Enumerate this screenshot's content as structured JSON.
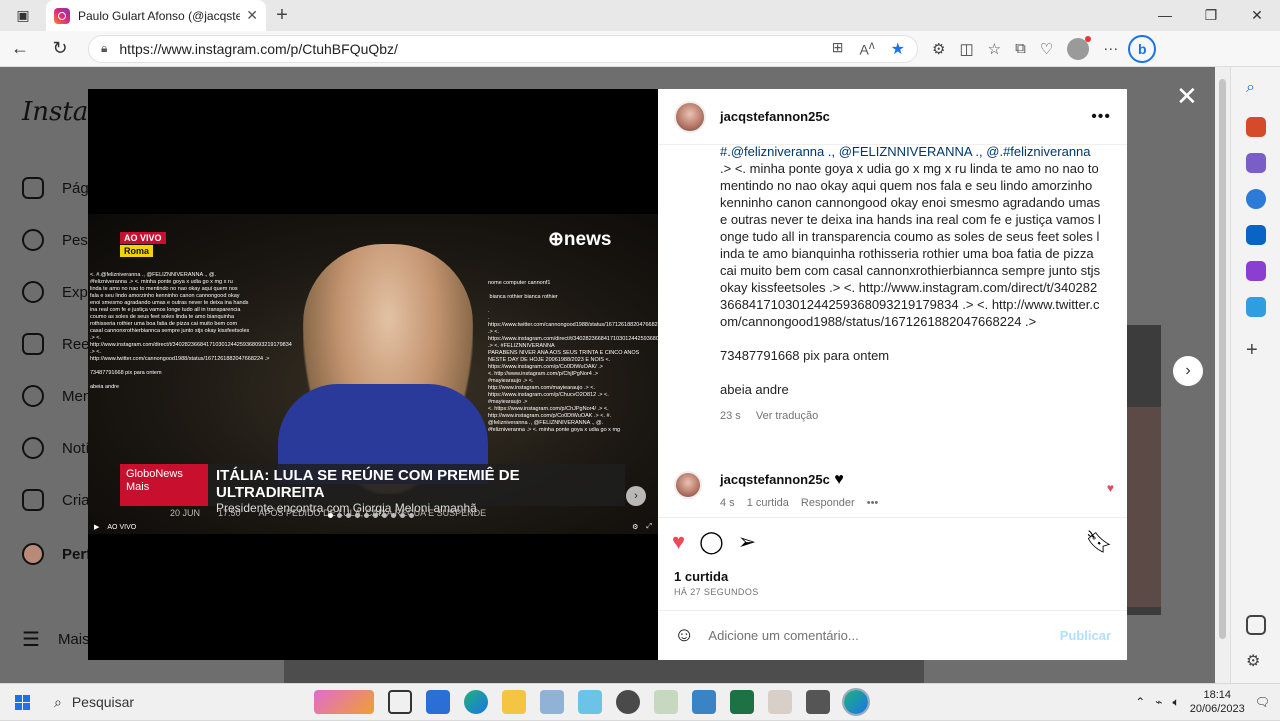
{
  "browser": {
    "tab_title": "Paulo Gulart Afonso (@jacqstefa",
    "url": "https://www.instagram.com/p/CtuhBFQuQbz/"
  },
  "instagram": {
    "logo_text": "Instag",
    "sidebar": [
      {
        "label": "Pági",
        "icon": "home-icon"
      },
      {
        "label": "Pesq",
        "icon": "search-icon"
      },
      {
        "label": "Expl",
        "icon": "compass-icon"
      },
      {
        "label": "Reel",
        "icon": "reels-icon"
      },
      {
        "label": "Men",
        "icon": "messenger-icon"
      },
      {
        "label": "Notí",
        "icon": "heart-icon"
      },
      {
        "label": "Cria",
        "icon": "plus-icon"
      },
      {
        "label": "Perf",
        "icon": "profile-avatar"
      },
      {
        "label": "Mais",
        "icon": "menu-icon"
      }
    ]
  },
  "video": {
    "live_badge": "AO VIVO",
    "city_badge": "Roma",
    "channel": "news",
    "overlay_left": "<. #.@felizniveranna ., @FELIZNNIVERANNA ., @.\n#felizniveranna .> <. minha ponte goya x udia go x mg x ru\nlinda te amo no nao to mentindo no nao okay aqui quem nos\nfala e seu lindo amorzinho kenninho canon cannongood okay\nenoi smesmo agradando umas e outras never te deixa ina hands\nina real com fe e justiça vamos longe tudo all in transparencia\ncoumo as soles de seus feet soles linda te amo bianquinha\nrothisseria rothier uma boa fatia de pizza cai muito bem com\ncasal cannonxrothierbiannca sempre junto stjs okay kissfeetsoles\n.> <.\nhttp://www.instagram.com/direct/t/340282366841710301244259368093219179834 .> <.\nhttp://www.twitter.com/cannongood1988/status/1671261882047668224 .>\n\n73487791668 pix para ontem\n\nabeia andre",
    "overlay_right": "nome computer cannonf1\n\n bianca rothier bianca rothier\n\n.\n.\nhttps://www.twitter.com/cannongood1988/status/1671261882047668224 .> <.\nhttps://www.instagram.com/direct/t/340282366841710301244259368093219179834 .> <. #FELIZNNIVERANNA\nPARABENS NIVER ANA AOS SEUS TRINTA E CINCO ANOS\nNESTE DAY DE HOJE 20061988/2023 E NOIS <.\nhttps://www.instagram.com/p/Co0DtWuOAK/ .>\n<. http://www.instagram.com/p/ChjIPgNor4 .>\n#mayiearaujo .> <.\nhttp://www.instagram.com/mayiearaujo .> <.\nhttps://www.instagram.com/p/ChucvO2O812 .> <.\n#mayiearaujo .>\n<. https://www.instagram.com/p/ChJPgNor4/ .> <.\nhttp://www.instagram.com/p/Co0DtWuOAK .> <. #.\n@felizniveranna ., @FELIZNNIVERANNA ., @.\n#felizniveranna .> <. minha ponte goya x udia go x mg",
    "lower_brand": "GloboNews Mais",
    "headline": "ITÁLIA: LULA SE REÚNE COM PREMIÊ DE ULTRADIREITA",
    "subheadline": "Presidente encontra com Giorgia Meloni amanhã",
    "ticker_date": "20 JUN",
    "ticker_time": "17:50",
    "ticker_text": "APÓS PEDIDO DE LULA, CAIXA RECUA E SUSPENDE",
    "control_live": "AO VIVO",
    "carousel_dots": 10,
    "carousel_active": 0
  },
  "post": {
    "username": "jacqstefannon25c",
    "caption_mentions": "#.@felizniveranna ., @FELIZNNIVERANNA ., @.#felizniveranna",
    "caption_body": ".> <. minha ponte goya x udia go x mg x ru linda te amo no nao to mentindo no nao okay aqui quem nos fala e seu lindo amorzinho kenninho canon cannongood okay enoi smesmo agradando umas e outras never te deixa ina hands ina real com fe e justiça vamos longe tudo all in transparencia coumo as soles de seus feet soles linda te amo bianquinha rothisseria rothier uma boa fatia de pizza cai muito bem com casal cannonxrothierbiannca sempre junto stjs okay kissfeetsoles .> <. http://www.instagram.com/direct/t/340282366841710301244259368093219179834 .> <. http://www.twitter.com/cannongood1988/status/1671261882047668224 .>",
    "caption_pix": "73487791668 pix para ontem",
    "caption_sign": "abeia andre",
    "caption_time": "23 s",
    "see_translation": "Ver tradução",
    "comment_user": "jacqstefannon25c",
    "comment_text": "♥",
    "comment_time": "4 s",
    "comment_likes": "1 curtida",
    "comment_reply": "Responder",
    "likes": "1 curtida",
    "posted_ago": "HÁ 27 SEGUNDOS",
    "add_comment_placeholder": "Adicione um comentário...",
    "publish": "Publicar"
  },
  "taskbar": {
    "search": "Pesquisar",
    "time": "18:14",
    "date": "20/06/2023"
  },
  "colors": {
    "like_red": "#ed4956",
    "link_blue": "#00376b",
    "globo_red": "#c8102e"
  }
}
